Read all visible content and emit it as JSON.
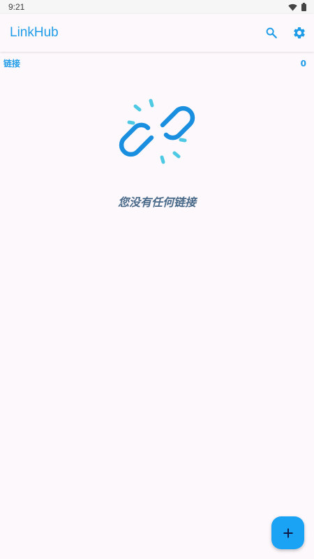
{
  "status_bar": {
    "time": "9:21",
    "icons": [
      "wifi-icon",
      "battery-icon"
    ]
  },
  "app_bar": {
    "title": "LinkHub",
    "actions": [
      "search-icon",
      "settings-icon"
    ]
  },
  "section": {
    "label": "链接",
    "count": "0"
  },
  "empty_state": {
    "icon": "broken-link-icon",
    "message": "您没有任何链接"
  },
  "fab": {
    "icon": "plus-icon"
  },
  "colors": {
    "accent": "#1e9ce8",
    "fab": "#1aa3f5",
    "background": "#fdf8fc",
    "empty_text": "#4a6a8a"
  }
}
